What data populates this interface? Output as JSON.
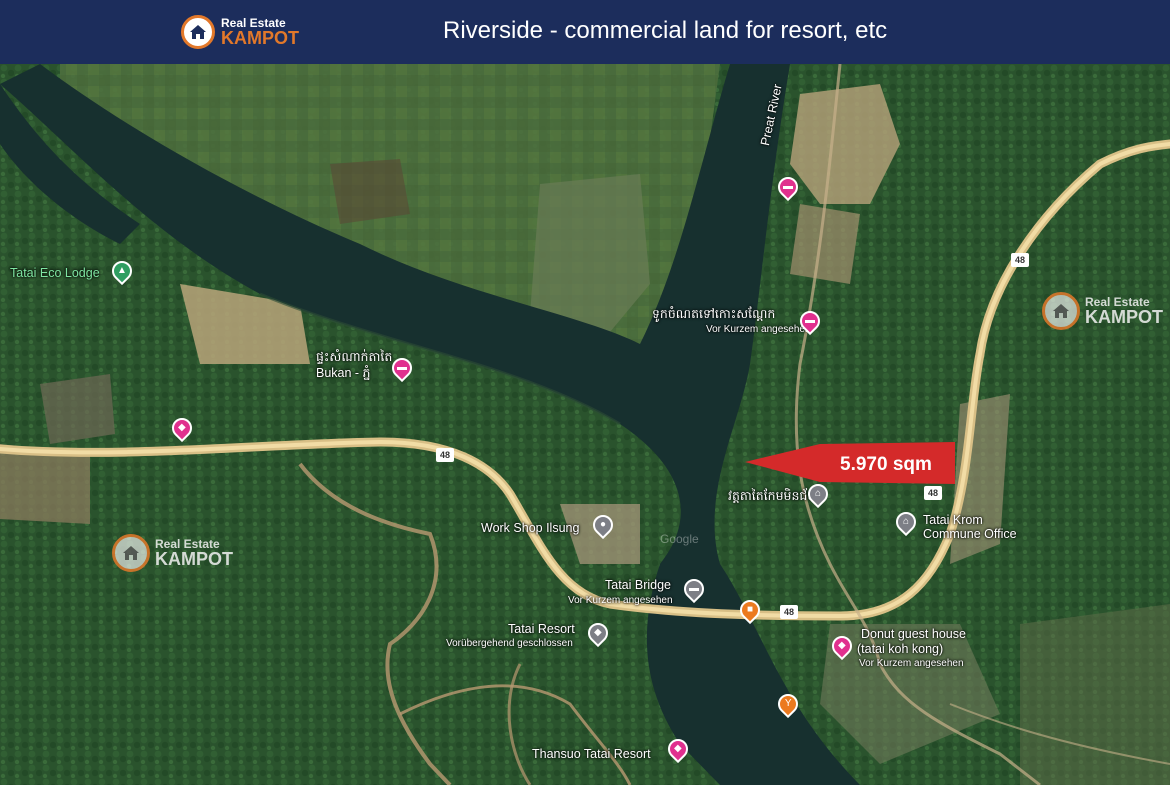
{
  "header": {
    "brand_small": "Real Estate",
    "brand_big": "KAMPOT",
    "title": "Riverside - commercial land for resort, etc"
  },
  "watermarks": [
    {
      "small": "Real Estate",
      "big": "KAMPOT"
    },
    {
      "small": "Real Estate",
      "big": "KAMPOT"
    }
  ],
  "map": {
    "river_name": "Preat River",
    "road_number": "48",
    "plot_area": "5.970 sqm",
    "map_watermark": "Google",
    "places": {
      "eco_lodge": "Tatai Eco Lodge",
      "guesthouse_khmer": "ផ្ទះសំណាក់តាតៃ",
      "bukan": "Bukan - ភ្នំ",
      "river_hotel": "ទូកចំណតទៅកោះសណ្ដែក",
      "river_hotel_status": "Vor Kurzem angesehen",
      "temple": "វត្តតាតៃកែមមិនជ័យ",
      "commune_name": "Tatai Krom",
      "commune_office": "Commune Office",
      "workshop": "Work Shop Ilsung",
      "bridge": "Tatai Bridge",
      "bridge_status": "Vor Kurzem angesehen",
      "resort": "Tatai Resort",
      "resort_status": "Vorübergehend geschlossen",
      "donut_line1": "Donut guest house",
      "donut_line2": "(tatai koh kong)",
      "donut_status": "Vor Kurzem angesehen",
      "thansuo": "Thansuo Tatai Resort"
    }
  },
  "colors": {
    "header_bg": "#1c2d5c",
    "brand_accent": "#e2782a",
    "arrow_red": "#d42a2a",
    "road": "#e4c98a",
    "river": "#17302f",
    "forest": "#27502b"
  },
  "icons": [
    "house-icon",
    "hotel-icon",
    "lodging-icon",
    "temple-icon",
    "office-icon",
    "bridge-icon",
    "cafe-icon",
    "bar-icon",
    "camping-icon",
    "landmark-icon"
  ]
}
